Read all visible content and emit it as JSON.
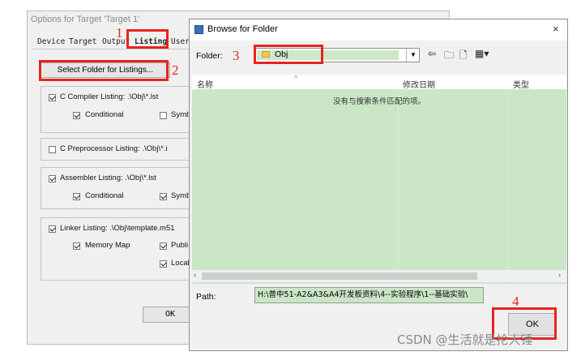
{
  "options_dialog": {
    "title": "Options for Target 'Target 1'",
    "tabs": [
      "Device",
      "Target",
      "Output",
      "Listing",
      "User"
    ],
    "select_folder_button": "Select Folder for Listings...",
    "ok_label": "OK",
    "groups": {
      "c_compiler": {
        "label": "C Compiler Listing:  .\\Obj\\*.lst",
        "checked": true,
        "options": [
          {
            "label": "Conditional",
            "checked": true
          },
          {
            "label": "Symb",
            "checked": false
          }
        ]
      },
      "c_preprocessor": {
        "label": "C Preprocessor Listing:  .\\Obj\\*.i",
        "checked": false
      },
      "assembler": {
        "label": "Assembler Listing:  .\\Obj\\*.lst",
        "checked": true,
        "options": [
          {
            "label": "Conditional",
            "checked": true
          },
          {
            "label": "Symb",
            "checked": true
          }
        ]
      },
      "linker": {
        "label": "Linker Listing:  .\\Obj\\template.m51",
        "checked": true,
        "options": [
          {
            "label": "Memory Map",
            "checked": true
          },
          {
            "label": "Publi",
            "checked": true
          },
          {
            "label": "Local",
            "checked": true
          }
        ]
      }
    }
  },
  "browse_dialog": {
    "title": "Browse for Folder",
    "close_glyph": "×",
    "folder_label": "Folder:",
    "folder_value": "Obj",
    "columns": [
      "名称",
      "修改日期",
      "类型"
    ],
    "sort_glyph": "^",
    "empty_message": "没有与搜索条件匹配的项。",
    "path_label": "Path:",
    "path_value": "H:\\普中51-A2&A3&A4开发板资料\\4--实验程序\\1--基础实验\\",
    "ok_label": "OK",
    "toolbar_icons": [
      "back-arrow-icon",
      "up-folder-icon",
      "new-folder-icon",
      "view-menu-icon"
    ]
  },
  "annotations": [
    "1",
    "2",
    "3",
    "4"
  ],
  "watermark": "CSDN @生活就是抡大锤",
  "colors": {
    "annotation_red": "#e8231e",
    "selection_green": "#cbe6c7"
  }
}
